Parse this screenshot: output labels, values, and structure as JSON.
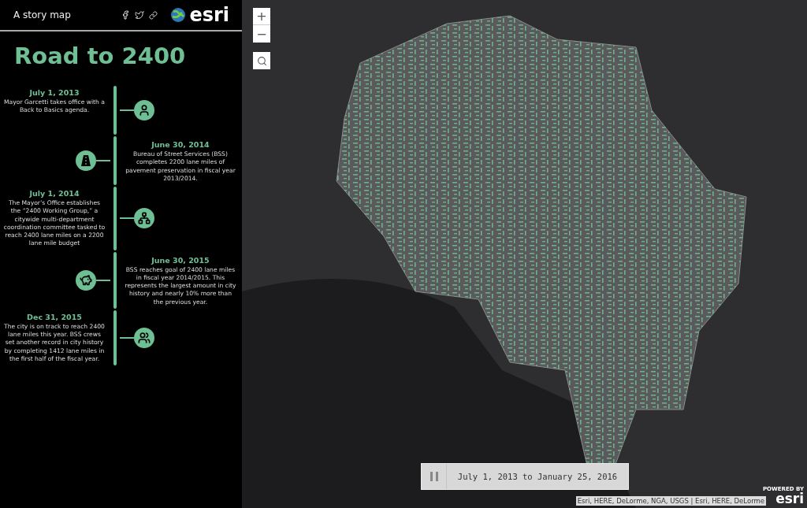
{
  "header": {
    "tagline": "A story map",
    "logo_text": "esri"
  },
  "title": "Road to 2400",
  "events": [
    {
      "date": "July 1, 2013",
      "text": "Mayor Garcetti takes office with a Back to Basics agenda.",
      "text_on_right": false,
      "kind": "person"
    },
    {
      "date": "June 30, 2014",
      "text": "Bureau of Street Services (BSS) completes 2200 lane miles of pavement preservation in fiscal year 2013/2014.",
      "text_on_right": true,
      "kind": "road"
    },
    {
      "date": "July 1, 2014",
      "text": "The Mayor’s Office establishes the “2400 Working Group,” a citywide multi-department coordination committee tasked to reach 2400 lane miles on a 2200 lane mile budget",
      "text_on_right": false,
      "kind": "network"
    },
    {
      "date": "June 30, 2015",
      "text": "BSS reaches goal of 2400 lane miles in fiscal year 2014/2015. This represents the largest amount in city history and nearly 10% more than the previous year.",
      "text_on_right": true,
      "kind": "savings"
    },
    {
      "date": "Dec 31, 2015",
      "text": "The city is on track to reach 2400 lane miles this year. BSS crews set another record in city history by completing 1412 lane miles in the first half of the fiscal year.",
      "text_on_right": false,
      "kind": "group"
    }
  ],
  "map": {
    "zoom_in": "+",
    "zoom_out": "−",
    "time_slider": {
      "label": "July 1, 2013 to January 25, 2016",
      "playing": true
    },
    "attribution": "Esri, HERE, DeLorme, NGA, USGS | Esri, HERE, DeLorme",
    "powered_by": {
      "caption": "POWERED BY",
      "logo": "esri"
    }
  }
}
